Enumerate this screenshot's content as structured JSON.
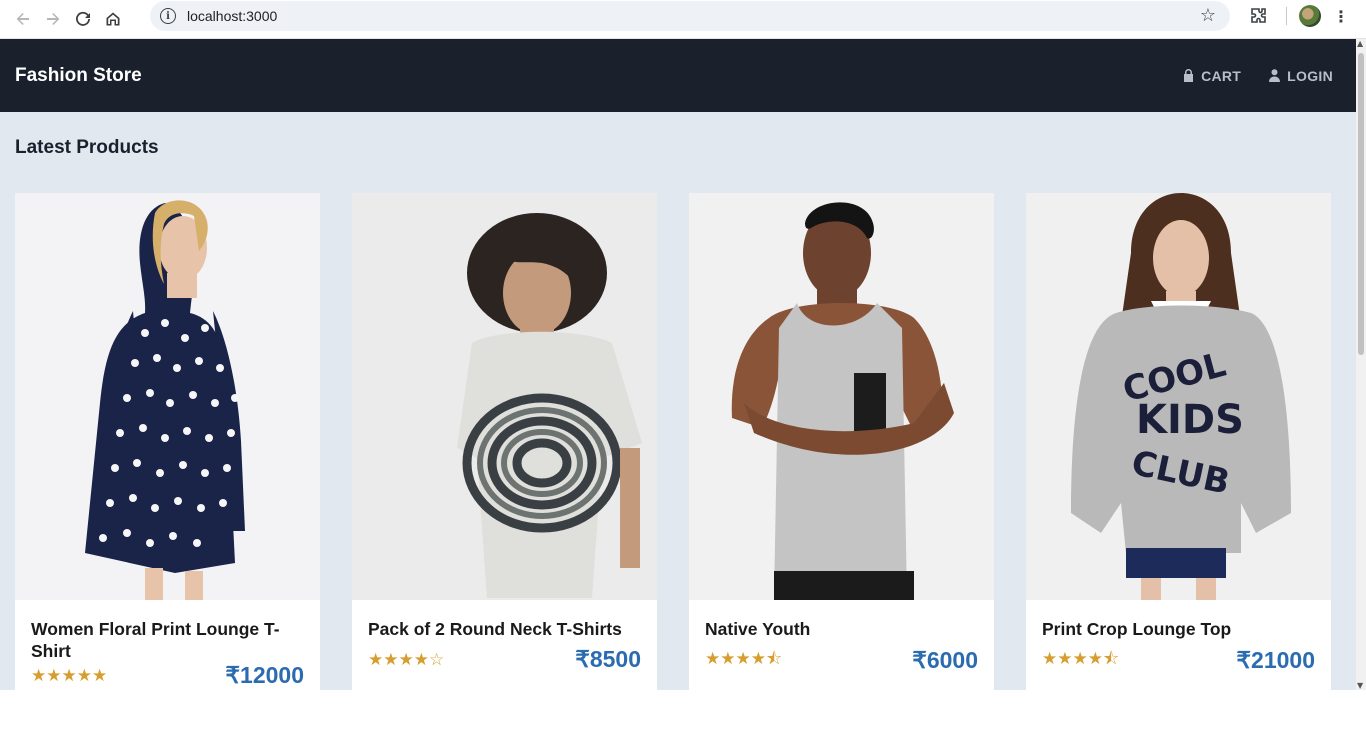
{
  "browser": {
    "url": "localhost:3000"
  },
  "header": {
    "brand": "Fashion Store",
    "cart_label": "CART",
    "login_label": "LOGIN"
  },
  "main": {
    "section_title": "Latest Products",
    "products": [
      {
        "title": "Women Floral Print Lounge T-Shirt",
        "stars": "★★★★★",
        "price": "₹12000"
      },
      {
        "title": "Pack of 2 Round Neck T-Shirts",
        "stars": "★★★★☆",
        "price": "₹8500"
      },
      {
        "title": "Native Youth",
        "stars": "★★★★⯪",
        "price": "₹6000"
      },
      {
        "title": "Print Crop Lounge Top",
        "stars": "★★★★⯪",
        "price": "₹21000"
      }
    ]
  },
  "colors": {
    "header_bg": "#1a202c",
    "page_bg": "#e2e8f0",
    "star": "#d69e2e",
    "price": "#2b6cb0"
  }
}
